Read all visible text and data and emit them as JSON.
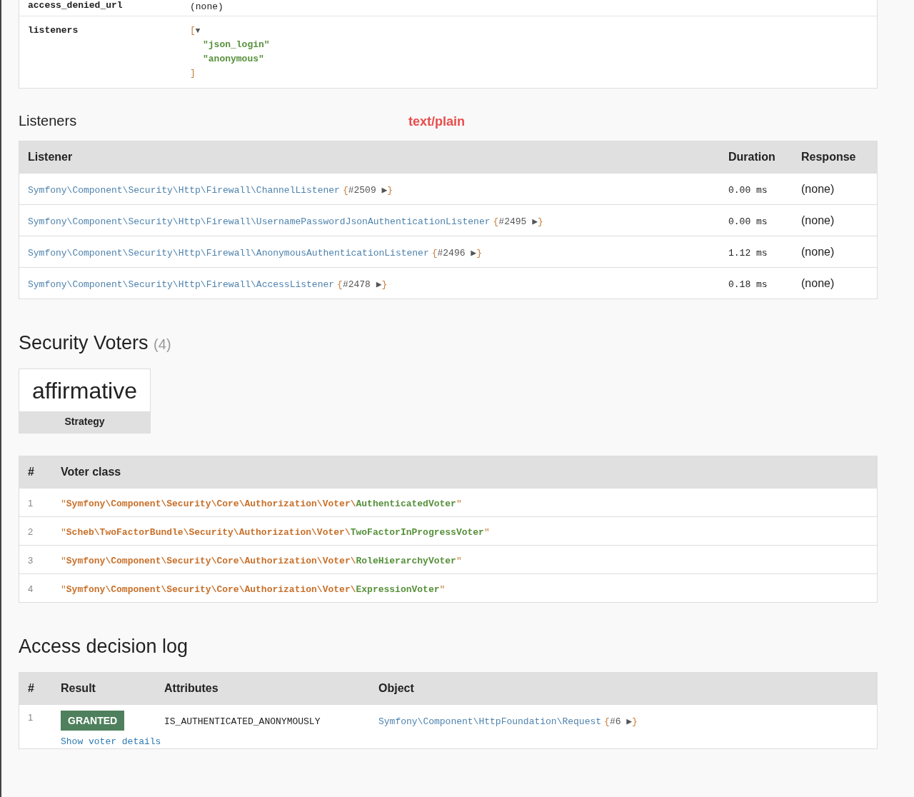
{
  "firewall_config": {
    "rows": [
      {
        "key": "access_denied_url",
        "kind": "text",
        "value": "(none)"
      },
      {
        "key": "listeners",
        "kind": "array",
        "open": "[",
        "toggle": "▼",
        "items": [
          "\"json_login\"",
          "\"anonymous\""
        ],
        "close": "]"
      }
    ]
  },
  "listeners": {
    "title": "Listeners",
    "annotation": "text/plain",
    "columns": [
      "Listener",
      "Duration",
      "Response"
    ],
    "rows": [
      {
        "listener": "Symfony\\Component\\Security\\Http\\Firewall\\ChannelListener",
        "ref": "{#2509 ▶}",
        "duration": "0.00 ms",
        "response": "(none)"
      },
      {
        "listener": "Symfony\\Component\\Security\\Http\\Firewall\\UsernamePasswordJsonAuthenticationListener",
        "ref": "{#2495 ▶}",
        "duration": "0.00 ms",
        "response": "(none)"
      },
      {
        "listener": "Symfony\\Component\\Security\\Http\\Firewall\\AnonymousAuthenticationListener",
        "ref": "{#2496 ▶}",
        "duration": "1.12 ms",
        "response": "(none)"
      },
      {
        "listener": "Symfony\\Component\\Security\\Http\\Firewall\\AccessListener",
        "ref": "{#2478 ▶}",
        "duration": "0.18 ms",
        "response": "(none)"
      }
    ]
  },
  "voters": {
    "title": "Security Voters",
    "count": "(4)",
    "metric": {
      "value": "affirmative",
      "label": "Strategy"
    },
    "columns": [
      "#",
      "Voter class"
    ],
    "rows": [
      {
        "number": "1",
        "voter": "\"Symfony\\Component\\Security\\Core\\Authorization\\Voter\\AuthenticatedVoter\""
      },
      {
        "number": "2",
        "voter": "\"Scheb\\TwoFactorBundle\\Security\\Authorization\\Voter\\TwoFactorInProgressVoter\""
      },
      {
        "number": "3",
        "voter": "\"Symfony\\Component\\Security\\Core\\Authorization\\Voter\\RoleHierarchyVoter\""
      },
      {
        "number": "4",
        "voter": "\"Symfony\\Component\\Security\\Core\\Authorization\\Voter\\ExpressionVoter\""
      }
    ]
  },
  "decision_log": {
    "title": "Access decision log",
    "columns": [
      "#",
      "Result",
      "Attributes",
      "Object"
    ],
    "rows": [
      {
        "number": "1",
        "result": "GRANTED",
        "granted": true,
        "attributes": "IS_AUTHENTICATED_ANONYMOUSLY",
        "object": "Symfony\\Component\\HttpFoundation\\Request",
        "ref": "{#6 ▶}",
        "details_link": "Show voter details"
      }
    ]
  }
}
